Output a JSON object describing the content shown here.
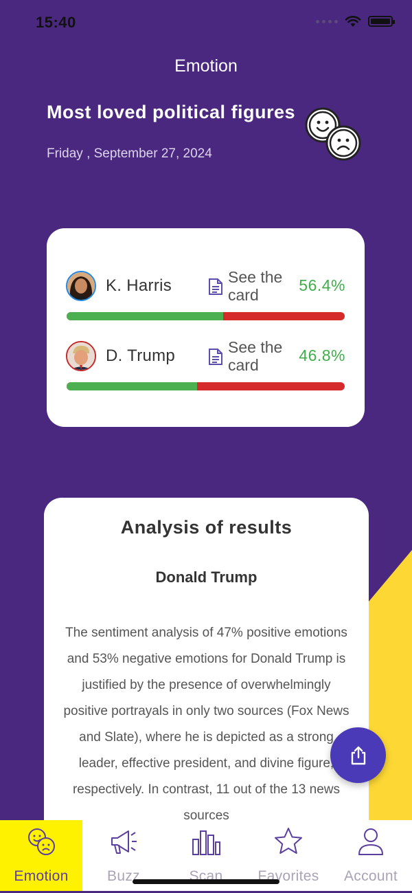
{
  "status_bar": {
    "time": "15:40"
  },
  "header": {
    "title": "Emotion"
  },
  "page": {
    "heading": "Most loved political figures",
    "date": "Friday , September 27, 2024",
    "icon": "happy-sad-faces-icon"
  },
  "ranking": [
    {
      "name": "K. Harris",
      "link_label": "See the card",
      "percent": "56.4%",
      "share": 56.4,
      "border_color": "#1e88e5"
    },
    {
      "name": "D. Trump",
      "link_label": "See the card",
      "percent": "46.8%",
      "share": 46.8,
      "border_color": "#c62828"
    }
  ],
  "analysis": {
    "title": "Analysis of results",
    "subject": "Donald Trump",
    "text": "The sentiment analysis of 47% positive emotions and 53% negative emotions for Donald Trump is justified by the presence of overwhelmingly positive portrayals in only two sources (Fox News and Slate), where he is depicted as a strong leader, effective president, and divine figure, respectively. In contrast, 11 out of the 13 news sources"
  },
  "fab": {
    "icon": "share-icon"
  },
  "tabs": [
    {
      "label": "Emotion",
      "icon": "emotion-faces-icon",
      "active": true
    },
    {
      "label": "Buzz",
      "icon": "megaphone-icon",
      "active": false
    },
    {
      "label": "Scan",
      "icon": "bar-chart-icon",
      "active": false
    },
    {
      "label": "Favorites",
      "icon": "star-icon",
      "active": false
    },
    {
      "label": "Account",
      "icon": "user-icon",
      "active": false
    }
  ],
  "colors": {
    "background": "#4b2880",
    "positive": "#4caf50",
    "negative": "#d62b2b",
    "percent_text": "#3fae4a",
    "accent": "#4a3ab8",
    "active_tab": "#fff200",
    "yellow_shape": "#fdd835"
  }
}
